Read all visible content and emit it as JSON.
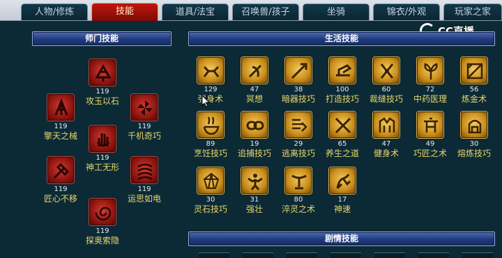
{
  "tabs": [
    {
      "label": "人物/修炼",
      "active": false
    },
    {
      "label": "技能",
      "active": true
    },
    {
      "label": "道具/法宝",
      "active": false
    },
    {
      "label": "召唤兽/孩子",
      "active": false
    },
    {
      "label": "坐骑",
      "active": false
    },
    {
      "label": "锦衣/外观",
      "active": false
    },
    {
      "label": "玩家之家",
      "active": false
    }
  ],
  "watermark": "CC直播",
  "sect_skills": {
    "title": "师门技能",
    "items": [
      {
        "level": "119",
        "name": "攻玉以石",
        "icon": "gem-crush-icon"
      },
      {
        "level": "119",
        "name": "擎天之械",
        "icon": "tower-mech-icon"
      },
      {
        "level": "119",
        "name": "千机奇巧",
        "icon": "pinwheel-icon"
      },
      {
        "level": "119",
        "name": "神工无形",
        "icon": "hand-icon"
      },
      {
        "level": "119",
        "name": "匠心不移",
        "icon": "hammer-icon"
      },
      {
        "level": "119",
        "name": "运思如电",
        "icon": "swirl-icon"
      },
      {
        "level": "119",
        "name": "探奥索隐",
        "icon": "vortex-icon"
      }
    ]
  },
  "life_skills": {
    "title": "生活技能",
    "items": [
      {
        "level": "129",
        "name": "强身术",
        "icon": "body-strength-icon"
      },
      {
        "level": "47",
        "name": "冥想",
        "icon": "meditation-icon"
      },
      {
        "level": "38",
        "name": "暗器技巧",
        "icon": "dart-icon"
      },
      {
        "level": "100",
        "name": "打造技巧",
        "icon": "forging-icon"
      },
      {
        "level": "60",
        "name": "裁缝技巧",
        "icon": "scissors-icon"
      },
      {
        "level": "72",
        "name": "中药医理",
        "icon": "herb-icon"
      },
      {
        "level": "56",
        "name": "炼金术",
        "icon": "alchemy-icon"
      },
      {
        "level": "89",
        "name": "烹饪技巧",
        "icon": "cooking-icon"
      },
      {
        "level": "19",
        "name": "追捕技巧",
        "icon": "chain-icon"
      },
      {
        "level": "29",
        "name": "逃离技巧",
        "icon": "escape-icon"
      },
      {
        "level": "65",
        "name": "养生之道",
        "icon": "health-icon"
      },
      {
        "level": "47",
        "name": "健身术",
        "icon": "fitness-icon"
      },
      {
        "level": "49",
        "name": "巧匠之术",
        "icon": "craftsman-icon"
      },
      {
        "level": "30",
        "name": "熔炼技巧",
        "icon": "smelting-icon"
      },
      {
        "level": "30",
        "name": "灵石技巧",
        "icon": "spirit-stone-icon"
      },
      {
        "level": "31",
        "name": "强壮",
        "icon": "muscle-icon"
      },
      {
        "level": "80",
        "name": "淬灵之术",
        "icon": "tempering-icon"
      },
      {
        "level": "17",
        "name": "神速",
        "icon": "speed-icon"
      }
    ]
  },
  "plot_skills": {
    "title": "剧情技能"
  },
  "colors": {
    "active_tab": "#b3120b",
    "panel_bg": "#0c2a36",
    "header_bar": "#2a4a94",
    "skill_name": "#e8d66a"
  }
}
